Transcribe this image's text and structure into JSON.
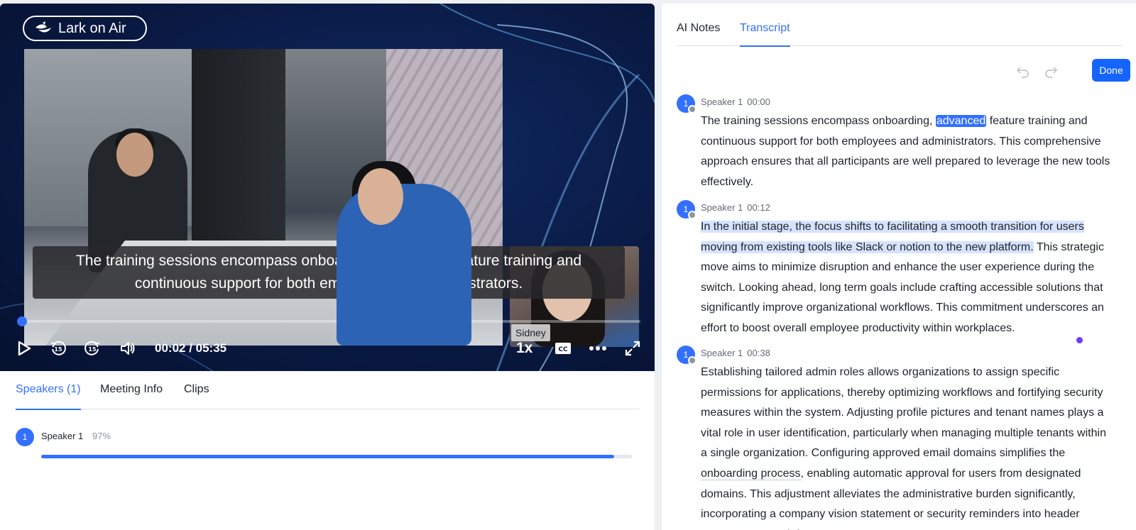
{
  "video": {
    "brand": "Lark on Air",
    "caption_line1": "The training sessions encompass onboarding, advanced feature training and",
    "caption_line2": "continuous support for both employees and administrators.",
    "pip_name": "Sidney",
    "time": "00:02 / 05:35",
    "speed": "1x",
    "progress_fraction": 0.006,
    "icons": [
      "play-icon",
      "rewind-15-icon",
      "forward-15-icon",
      "volume-icon",
      "cc-icon",
      "more-icon",
      "fullscreen-icon"
    ]
  },
  "left_tabs": [
    {
      "label": "Speakers (1)",
      "active": true
    },
    {
      "label": "Meeting Info",
      "active": false
    },
    {
      "label": "Clips",
      "active": false
    }
  ],
  "speakers": [
    {
      "avatar": "1",
      "name": "Speaker 1",
      "percent": "97%",
      "share": 0.97
    }
  ],
  "right_tabs": [
    {
      "label": "AI Notes",
      "active": false
    },
    {
      "label": "Transcript",
      "active": true
    }
  ],
  "toolbar": {
    "done_label": "Done"
  },
  "transcript": [
    {
      "avatar": "1",
      "speaker": "Speaker 1",
      "time": "00:00",
      "pre": "The training sessions encompass onboarding, ",
      "highlight_word": "advanced",
      "post": " feature training and continuous support for both employees and administrators. This comprehensive approach ensures that all participants are well prepared to leverage the new tools effectively."
    },
    {
      "avatar": "1",
      "speaker": "Speaker 1",
      "time": "00:12",
      "highlight_range": "In the initial stage, the focus shifts to facilitating a smooth transition for users moving from existing tools like Slack or notion to the new platform.",
      "post": " This strategic move aims to minimize disruption and enhance the user experience during the switch. Looking ahead, long term goals include crafting accessible solutions that significantly improve organizational workflows. This commitment underscores an effort to boost overall employee productivity within workplaces."
    },
    {
      "avatar": "1",
      "speaker": "Speaker 1",
      "time": "00:38",
      "pre": "Establishing tailored admin roles allows organizations to assign specific permissions for applications, thereby optimizing workflows and fortifying security measures within the system. Adjusting profile pictures and tenant names plays a vital role in user identification, particularly when managing multiple tenants within a single organization. Configuring approved email domains simplifies the ",
      "dotted": "onboarding process",
      "post": ", enabling automatic approval for users from designated domains. This adjustment alleviates the administrative burden significantly, incorporating a company vision statement or security reminders into header messages can reinforce"
    }
  ]
}
